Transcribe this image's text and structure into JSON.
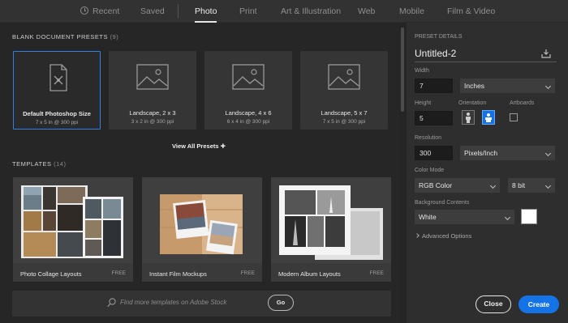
{
  "tabs": [
    {
      "label": "Recent",
      "icon": "clock-icon"
    },
    {
      "label": "Saved"
    },
    {
      "label": "Photo",
      "active": true
    },
    {
      "label": "Print"
    },
    {
      "label": "Art & Illustration"
    },
    {
      "label": "Web"
    },
    {
      "label": "Mobile"
    },
    {
      "label": "Film & Video"
    }
  ],
  "blank_presets": {
    "heading": "BLANK DOCUMENT PRESETS",
    "count": "(9)",
    "items": [
      {
        "name": "Default Photoshop Size",
        "dims": "7 x 5 in @ 300 ppi",
        "icon": "document-icon",
        "selected": true
      },
      {
        "name": "Landscape, 2 x 3",
        "dims": "3 x 2 in @ 300 ppi",
        "icon": "image-icon"
      },
      {
        "name": "Landscape, 4 x 6",
        "dims": "6 x 4 in @ 300 ppi",
        "icon": "image-icon"
      },
      {
        "name": "Landscape, 5 x 7",
        "dims": "7 x 5 in @ 300 ppi",
        "icon": "image-icon"
      }
    ],
    "view_all": "View All Presets",
    "view_all_icon": "plus-icon"
  },
  "templates": {
    "heading": "TEMPLATES",
    "count": "(14)",
    "items": [
      {
        "name": "Photo Collage Layouts",
        "badge": "FREE"
      },
      {
        "name": "Instant Film Mockups",
        "badge": "FREE"
      },
      {
        "name": "Modern Album Layouts",
        "badge": "FREE"
      }
    ]
  },
  "stock": {
    "placeholder": "Find more templates on Adobe Stock",
    "go_label": "Go",
    "icon": "search-icon"
  },
  "details": {
    "heading": "PRESET DETAILS",
    "title": "Untitled-2",
    "save_icon": "save-preset-icon",
    "width_label": "Width",
    "width_value": "7",
    "width_unit": "Inches",
    "height_label": "Height",
    "height_value": "5",
    "orientation_label": "Orientation",
    "orientation_icons": [
      "portrait-icon",
      "landscape-icon"
    ],
    "orientation_selected": "landscape",
    "artboards_label": "Artboards",
    "artboards_checked": false,
    "resolution_label": "Resolution",
    "resolution_value": "300",
    "resolution_unit": "Pixels/Inch",
    "color_mode_label": "Color Mode",
    "color_mode": "RGB Color",
    "bit_depth": "8 bit",
    "background_label": "Background Contents",
    "background": "White",
    "background_color": "#ffffff",
    "advanced": "Advanced Options"
  },
  "actions": {
    "close_label": "Close",
    "create_label": "Create"
  },
  "colors": {
    "accent": "#1473e6",
    "selected_border": "#2f7fe0"
  }
}
